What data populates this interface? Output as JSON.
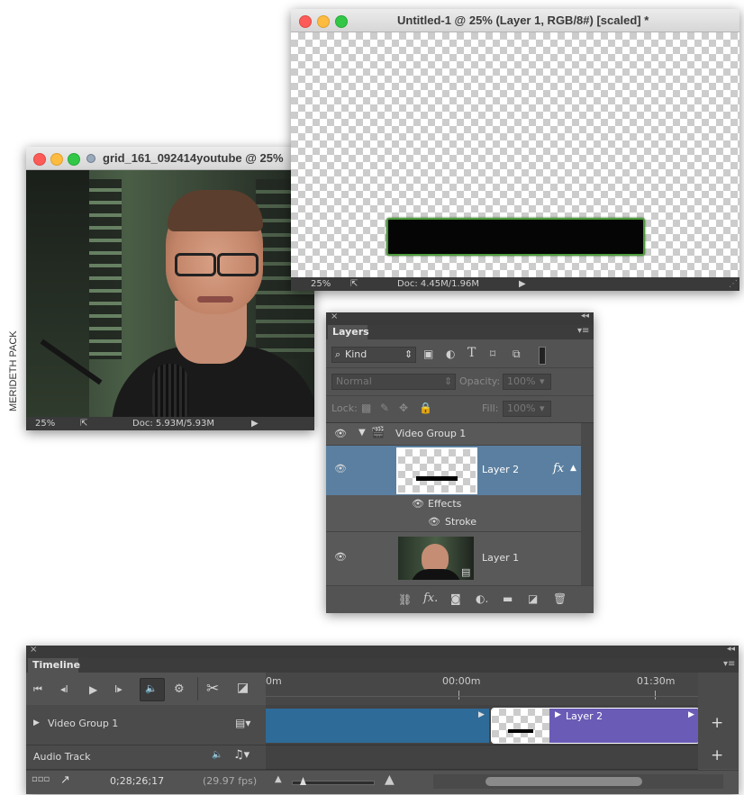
{
  "side_credit": "MERIDETH PACK",
  "untitled_window": {
    "title": "Untitled-1 @ 25% (Layer 1, RGB/8#) [scaled] *",
    "zoom": "25%",
    "doc_info": "Doc: 4.45M/1.96M"
  },
  "video_window": {
    "title": "grid_161_092414youtube @ 25%",
    "zoom": "25%",
    "doc_info": "Doc: 5.93M/5.93M"
  },
  "layers_panel": {
    "tab_label": "Layers",
    "kind_label": "Kind",
    "blend_mode": "Normal",
    "opacity_label": "Opacity:",
    "opacity_value": "100%",
    "lock_label": "Lock:",
    "fill_label": "Fill:",
    "fill_value": "100%",
    "group_name": "Video Group 1",
    "layer2_name": "Layer 2",
    "effects_label": "Effects",
    "stroke_label": "Stroke",
    "layer1_name": "Layer 1",
    "fx_label": "fx"
  },
  "timeline_panel": {
    "tab_label": "Timeline",
    "ruler_left": "0m",
    "ruler_mid": "00:00m",
    "ruler_right": "01:30m",
    "track_group": "Video Group 1",
    "track_audio": "Audio Track",
    "clip_label": "Layer 2",
    "timecode": "0;28;26;17",
    "fps": "(29.97 fps)",
    "colors": {
      "clip_blue": "#2e6b98",
      "clip_purple": "#6a5bb6"
    }
  }
}
